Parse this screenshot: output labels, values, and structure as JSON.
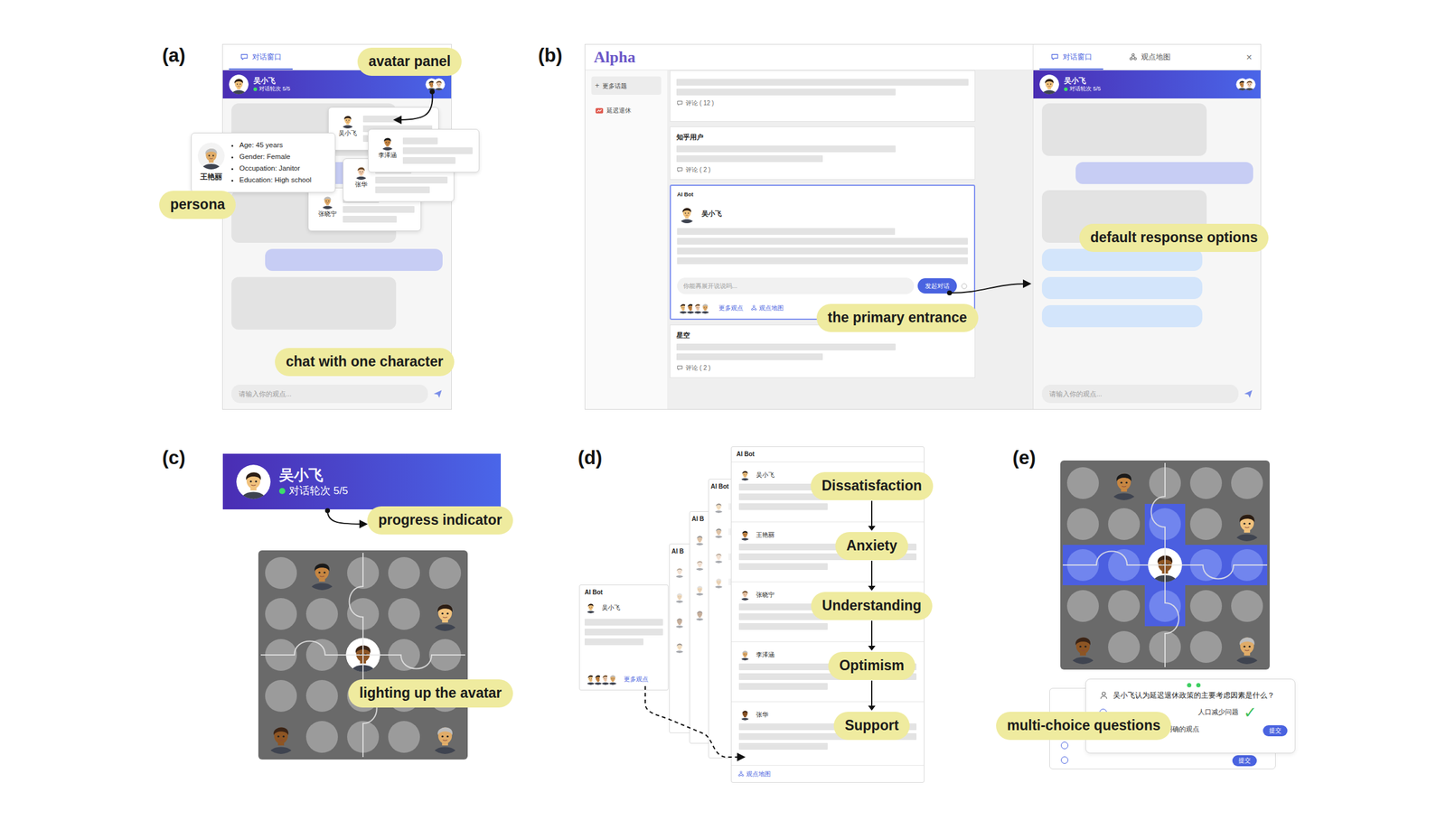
{
  "figure_a": {
    "label": "(a)",
    "tabs": [
      {
        "label": "对话窗口",
        "selected": true
      }
    ],
    "header": {
      "name": "吴小飞",
      "progress": "对话轮次 5/5"
    },
    "messages": [
      {
        "kind": "bot"
      },
      {
        "kind": "user"
      },
      {
        "kind": "bot"
      },
      {
        "kind": "user"
      },
      {
        "kind": "bot"
      }
    ],
    "character_cards": [
      {
        "name": "吴小飞"
      },
      {
        "name": "李泽涵"
      },
      {
        "name": "张华"
      },
      {
        "name": "张晓宁"
      }
    ],
    "persona": {
      "name": "王艳丽",
      "facts": [
        "Age: 45 years",
        "Gender: Female",
        "Occupation: Janitor",
        "Education: High school"
      ]
    },
    "input": {
      "placeholder": "请输入你的观点..."
    },
    "callouts": [
      "avatar panel",
      "persona",
      "chat with one character"
    ]
  },
  "figure_b": {
    "label": "(b)",
    "logo": "Alpha",
    "sidebar": [
      {
        "kind": "button",
        "icon": "+",
        "label": "更多话题"
      },
      {
        "kind": "topic",
        "label": "延迟退休"
      }
    ],
    "feed": [
      {
        "kind": "post",
        "comments": "评论 ( 12 )"
      },
      {
        "kind": "post",
        "author": "知乎用户",
        "comments": "评论 ( 2 )"
      },
      {
        "kind": "bot",
        "tag": "AI Bot",
        "author": "吴小飞",
        "input": {
          "placeholder": "你能再展开说说吗..."
        },
        "button": "发起对话",
        "links": [
          "更多观点",
          "观点地图"
        ]
      },
      {
        "kind": "post",
        "author": "星空",
        "comments": "评论 ( 2 )"
      }
    ],
    "chat": {
      "tabs": [
        {
          "label": "对话窗口",
          "selected": true
        },
        {
          "label": "观点地图",
          "selected": false
        }
      ],
      "close": "×",
      "header": {
        "name": "吴小飞",
        "progress": "对话轮次 5/5"
      },
      "messages": [
        {
          "kind": "bot"
        },
        {
          "kind": "user"
        },
        {
          "kind": "bot"
        },
        {
          "kind": "option"
        },
        {
          "kind": "option"
        },
        {
          "kind": "option"
        }
      ],
      "input": {
        "placeholder": "请输入你的观点..."
      }
    },
    "callouts": [
      "the primary entrance",
      "default response options"
    ]
  },
  "figure_c": {
    "label": "(c)",
    "header": {
      "name": "吴小飞",
      "progress": "对话轮次 5/5"
    },
    "grid": [
      [
        {
          "kind": "empty",
          "lit": false
        },
        {
          "kind": "avatar",
          "lit": false
        },
        {
          "kind": "empty",
          "lit": false
        },
        {
          "kind": "empty",
          "lit": false
        },
        {
          "kind": "empty",
          "lit": false
        }
      ],
      [
        {
          "kind": "empty",
          "lit": false
        },
        {
          "kind": "empty",
          "lit": false
        },
        {
          "kind": "empty",
          "lit": false
        },
        {
          "kind": "empty",
          "lit": false
        },
        {
          "kind": "avatar",
          "lit": false
        }
      ],
      [
        {
          "kind": "empty",
          "lit": false
        },
        {
          "kind": "empty",
          "lit": false
        },
        {
          "kind": "avatar",
          "lit": true
        },
        {
          "kind": "empty",
          "lit": false
        },
        {
          "kind": "empty",
          "lit": false
        }
      ],
      [
        {
          "kind": "empty",
          "lit": false
        },
        {
          "kind": "empty",
          "lit": false
        },
        {
          "kind": "empty",
          "lit": false
        },
        {
          "kind": "empty",
          "lit": false
        },
        {
          "kind": "empty",
          "lit": false
        }
      ],
      [
        {
          "kind": "avatar",
          "lit": false
        },
        {
          "kind": "empty",
          "lit": false
        },
        {
          "kind": "empty",
          "lit": false
        },
        {
          "kind": "empty",
          "lit": false
        },
        {
          "kind": "avatar",
          "lit": false
        }
      ]
    ],
    "callouts": [
      "progress indicator",
      "lighting up the avatar"
    ]
  },
  "figure_d": {
    "label": "(d)",
    "back_cards": [
      "AI Bot",
      "AI B",
      "AI B"
    ],
    "first_card": {
      "tag": "AI Bot",
      "name": "吴小飞",
      "link": "更多观点"
    },
    "viewpoints": {
      "tag": "AI Bot",
      "items": [
        {
          "name": "吴小飞",
          "emotion": "Dissatisfaction"
        },
        {
          "name": "王艳丽",
          "emotion": "Anxiety"
        },
        {
          "name": "张晓宁",
          "emotion": "Understanding"
        },
        {
          "name": "李泽涵",
          "emotion": "Optimism"
        },
        {
          "name": "张华",
          "emotion": "Support"
        }
      ],
      "link": "观点地图"
    }
  },
  "figure_e": {
    "label": "(e)",
    "grid": [
      [
        {
          "kind": "empty",
          "lit": false
        },
        {
          "kind": "avatar",
          "lit": false
        },
        {
          "kind": "empty",
          "lit": false
        },
        {
          "kind": "empty",
          "lit": false
        },
        {
          "kind": "empty",
          "lit": false
        }
      ],
      [
        {
          "kind": "empty",
          "lit": false
        },
        {
          "kind": "empty",
          "lit": false
        },
        {
          "kind": "empty",
          "lit": true
        },
        {
          "kind": "empty",
          "lit": false
        },
        {
          "kind": "avatar",
          "lit": false
        }
      ],
      [
        {
          "kind": "empty",
          "lit": true
        },
        {
          "kind": "empty",
          "lit": true
        },
        {
          "kind": "avatar",
          "lit": true
        },
        {
          "kind": "empty",
          "lit": true
        },
        {
          "kind": "empty",
          "lit": true
        }
      ],
      [
        {
          "kind": "empty",
          "lit": false
        },
        {
          "kind": "empty",
          "lit": false
        },
        {
          "kind": "empty",
          "lit": true
        },
        {
          "kind": "empty",
          "lit": false
        },
        {
          "kind": "empty",
          "lit": false
        }
      ],
      [
        {
          "kind": "avatar",
          "lit": false
        },
        {
          "kind": "empty",
          "lit": false
        },
        {
          "kind": "empty",
          "lit": false
        },
        {
          "kind": "empty",
          "lit": false
        },
        {
          "kind": "avatar",
          "lit": false
        }
      ]
    ],
    "quiz": {
      "question": "吴小飞认为延迟退休政策的主要考虑因素是什么？",
      "options": [
        {
          "text": "人口减少问题",
          "correct": true
        },
        {
          "text": "C.中立，没有表达明确的观点",
          "correct": false
        }
      ],
      "check": "✓",
      "submit": "提交",
      "back_submit": "提交"
    },
    "callouts": [
      "multi-choice questions"
    ]
  }
}
